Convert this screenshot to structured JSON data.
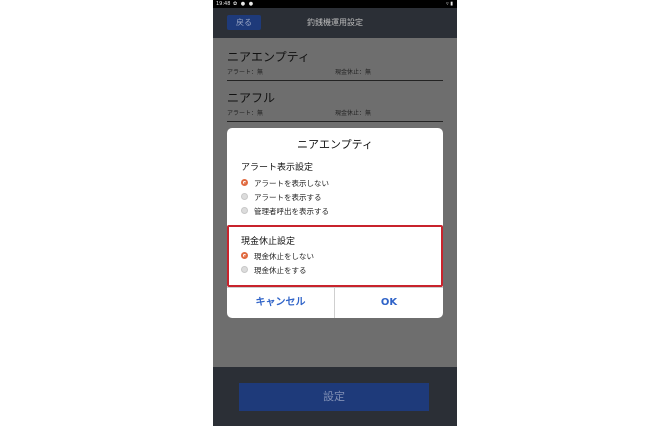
{
  "status_bar": {
    "time": "19:48",
    "left_icons": "✿ ● ●",
    "right_icons": "▿ ▮"
  },
  "app_bar": {
    "back_label": "戻る",
    "title": "釣銭機運用設定"
  },
  "settings": [
    {
      "name": "ニアエンプティ",
      "alert": "アラート：無",
      "cash_stop": "現金休止：無"
    },
    {
      "name": "ニアフル",
      "alert": "アラート：無",
      "cash_stop": "現金休止：無"
    }
  ],
  "dialog": {
    "title": "ニアエンプティ",
    "alert_section": {
      "heading": "アラート表示設定",
      "options": [
        "アラートを表示しない",
        "アラートを表示する",
        "管理者呼出を表示する"
      ],
      "selected": 0
    },
    "cash_section": {
      "heading": "現金休止設定",
      "options": [
        "現金休止をしない",
        "現金休止をする"
      ],
      "selected": 0
    },
    "cancel_label": "キャンセル",
    "ok_label": "OK"
  },
  "footer": {
    "set_label": "設定"
  },
  "colors": {
    "accent": "#e06a40",
    "highlight": "#c8232c",
    "dialog_button": "#2f63c8",
    "primary": "#1e3a7a"
  }
}
